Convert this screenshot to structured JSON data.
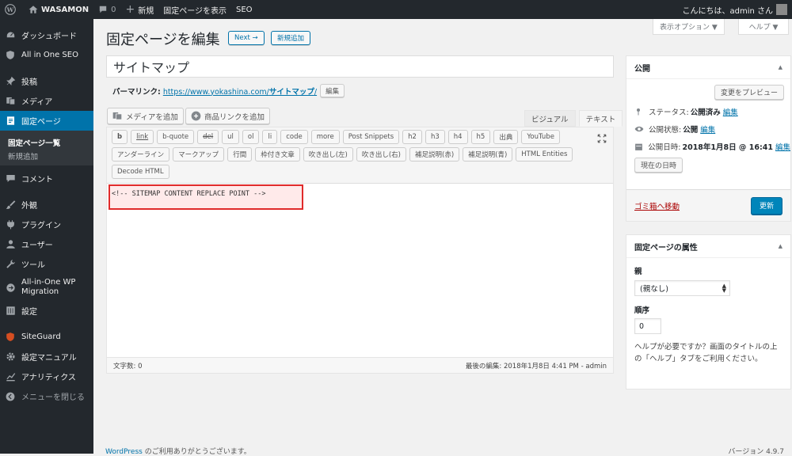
{
  "adminbar": {
    "site": "WASAMON",
    "comments": "0",
    "new": "新規",
    "view": "固定ページを表示",
    "seo": "SEO",
    "greeting": "こんにちは、admin さん"
  },
  "sidebar": {
    "items": [
      {
        "label": "ダッシュボード",
        "icon": "dashboard-icon"
      },
      {
        "label": "All in One SEO",
        "icon": "shield-icon"
      },
      {
        "label": "投稿",
        "icon": "pin-icon"
      },
      {
        "label": "メディア",
        "icon": "media-icon"
      },
      {
        "label": "固定ページ",
        "icon": "pages-icon"
      },
      {
        "label": "コメント",
        "icon": "comment-icon"
      },
      {
        "label": "外観",
        "icon": "brush-icon"
      },
      {
        "label": "プラグイン",
        "icon": "plugin-icon"
      },
      {
        "label": "ユーザー",
        "icon": "user-icon"
      },
      {
        "label": "ツール",
        "icon": "wrench-icon"
      },
      {
        "label": "All-in-One WP Migration",
        "icon": "migration-icon"
      },
      {
        "label": "設定",
        "icon": "settings-icon"
      },
      {
        "label": "SiteGuard",
        "icon": "siteguard-icon"
      },
      {
        "label": "設定マニュアル",
        "icon": "gear-icon"
      },
      {
        "label": "アナリティクス",
        "icon": "chart-icon"
      },
      {
        "label": "メニューを閉じる",
        "icon": "collapse-icon"
      }
    ],
    "submenu": [
      "固定ページ一覧",
      "新規追加"
    ]
  },
  "header": {
    "title": "固定ページを編集",
    "next": "Next →",
    "add_new": "新規追加",
    "screen_options": "表示オプション ▼",
    "help": "ヘルプ ▼"
  },
  "post": {
    "title": "サイトマップ",
    "permalink_label": "パーマリンク:",
    "permalink_base": "https://www.yokashina.com/",
    "permalink_slug": "サイトマップ",
    "permalink_suffix": "/",
    "edit": "編集"
  },
  "media": {
    "add_media": "メディアを追加",
    "product_link": "商品リンクを追加"
  },
  "tabs": {
    "visual": "ビジュアル",
    "text": "テキスト"
  },
  "quicktags": {
    "row1": [
      "b",
      "link",
      "b-quote",
      "del",
      "ul",
      "ol",
      "li",
      "code",
      "more",
      "Post Snippets",
      "h2",
      "h3",
      "h4",
      "h5",
      "出典",
      "YouTube"
    ],
    "row2": [
      "アンダーライン",
      "マークアップ",
      "行間",
      "枠付き文章",
      "吹き出し(左)",
      "吹き出し(右)",
      "補足説明(赤)",
      "補足説明(青)",
      "HTML Entities"
    ],
    "row3": [
      "Decode HTML"
    ]
  },
  "content": "<!-- SITEMAP CONTENT REPLACE POINT -->",
  "status": {
    "word_count": "文字数: 0",
    "last_edit": "最後の編集: 2018年1月8日 4:41 PM - admin"
  },
  "publish": {
    "title": "公開",
    "preview": "変更をプレビュー",
    "status_label": "ステータス:",
    "status_value": "公開済み",
    "visibility_label": "公開状態:",
    "visibility_value": "公開",
    "date_label": "公開日時:",
    "date_value": "2018年1月8日 @ 16:41",
    "edit": "編集",
    "now": "現在の日時",
    "trash": "ゴミ箱へ移動",
    "update": "更新"
  },
  "attributes": {
    "title": "固定ページの属性",
    "parent_label": "親",
    "parent_value": "(親なし)",
    "order_label": "順序",
    "order_value": "0",
    "help_text": "ヘルプが必要ですか？画面のタイトルの上の「ヘルプ」タブをご利用ください。"
  },
  "footer": {
    "link": "WordPress",
    "text": " のご利用ありがとうございます。",
    "version": "バージョン 4.9.7"
  }
}
